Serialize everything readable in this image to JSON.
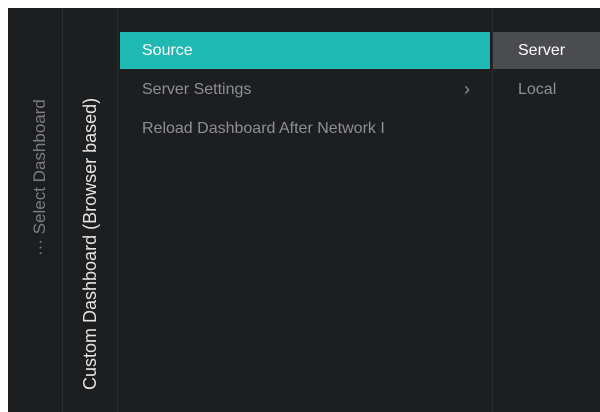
{
  "breadcrumb": {
    "label": "··· Select Dashboard"
  },
  "panel": {
    "title": "Custom Dashboard (Browser based)"
  },
  "menu": {
    "items": [
      {
        "label": "Source",
        "selected": true
      },
      {
        "label": "Server Settings",
        "has_submenu": true,
        "chevron": "›"
      },
      {
        "label": "Reload Dashboard After Network I"
      }
    ]
  },
  "source_options": {
    "items": [
      {
        "label": "Server",
        "selected": true
      },
      {
        "label": "Local",
        "selected": false
      }
    ]
  },
  "colors": {
    "background": "#1d1e20",
    "accent": "#20b8b2",
    "selected_option": "#4b4c4f",
    "muted_text": "#8e8f93"
  },
  "icons": {
    "submenu": "chevron-right-icon"
  }
}
